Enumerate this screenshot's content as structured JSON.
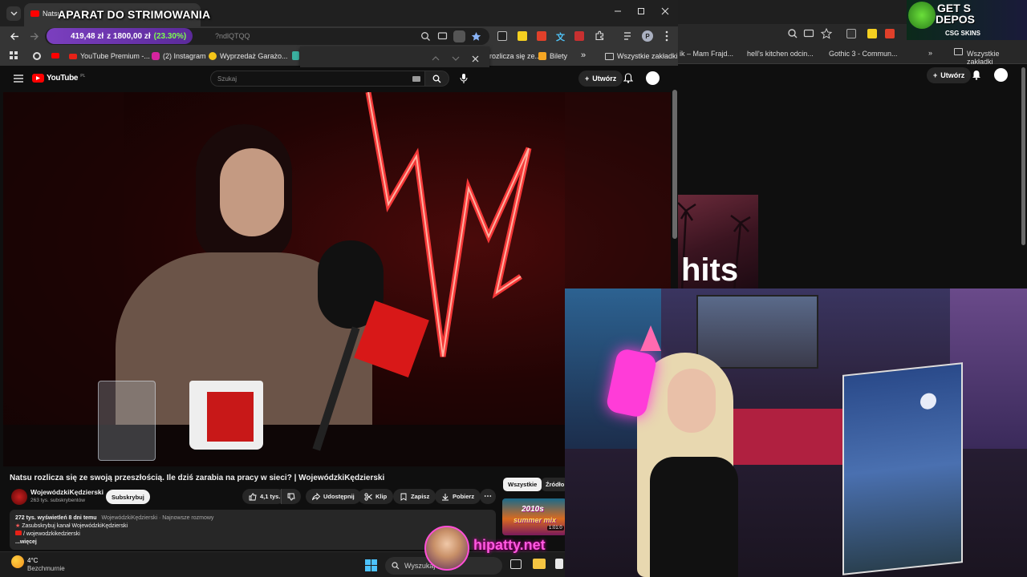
{
  "overlay": {
    "stream_title": "APARAT DO STRIMOWANIA",
    "price_current": "419,48 zł",
    "price_target": "z 1800,00 zł",
    "price_percent": "(23.30%)",
    "progress_fraction": 0.233,
    "logo_text": "hipatty.net"
  },
  "browser": {
    "tab_title": "Natsu",
    "url_tail": "?ndlQTQQ",
    "bookmarks": [
      {
        "label": "YouTube Premium -...",
        "color": "#e62117"
      },
      {
        "label": "(2) Instagram",
        "color": "#d6249f"
      },
      {
        "label": "Wyprzedaż Garażo...",
        "color": "#f5c518"
      },
      {
        "label": "rozlicza się ze...",
        "color": "#e62117"
      },
      {
        "label": "Bilety",
        "color": "#f5a623"
      }
    ],
    "more_bookmarks": "»",
    "all_bookmarks": "Wszystkie zakładki",
    "profile_letter": "P"
  },
  "background_browser": {
    "bookmarks": [
      "ik – Mam Frajd...",
      "hell's kitchen odcin...",
      "Gothic 3 - Commun..."
    ],
    "all_bookmarks": "Wszystkie zakładki",
    "create_label": "Utwórz",
    "thumb_text": "hits",
    "ad_line1": "GET S",
    "ad_line2": "DEPOS",
    "ad_brand": "CSG SKINS"
  },
  "youtube": {
    "logo": "YouTube",
    "logo_region": "PL",
    "search_placeholder": "Szukaj",
    "create_label": "Utwórz",
    "video_title": "Natsu rozlicza się ze swoją przeszłością. Ile dziś zarabia na pracy w sieci? | WojewódzkiKędzierski",
    "channel_name": "WojewódzkiKędzierski",
    "subscribers": "263 tys. subskrybentów",
    "subscribe_label": "Subskrybuj",
    "likes": "4,1 tys.",
    "share_label": "Udostępnij",
    "clip_label": "Klip",
    "save_label": "Zapisz",
    "download_label": "Pobierz",
    "desc_stats": "272 tys. wyświetleń  8 dni temu",
    "desc_tags": "WojewódzkiKędzierski · Najnowsze rozmowy",
    "desc_line2": "Zasubskrybuj kanał WojewódzkiKędzierski",
    "desc_line3": "/ wojewodzkikedzierski",
    "desc_more": "...więcej",
    "chip_all": "Wszystkie",
    "chip_sources": "Źródło",
    "rec_text1": "2010s",
    "rec_text2": "summer mix",
    "rec_duration": "1:01:0"
  },
  "taskbar": {
    "weather_temp": "4°C",
    "weather_desc": "Bezchmurnie",
    "search_placeholder": "Wyszukaj"
  },
  "colors": {
    "yt_red": "#ff0000",
    "accent_purple": "#7b3fbf",
    "progress_green": "#7cff4f",
    "logo_pink": "#ff5ae0"
  }
}
